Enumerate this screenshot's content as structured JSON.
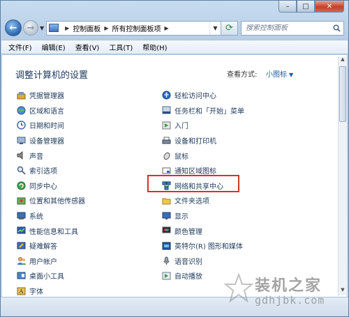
{
  "window": {
    "caption_buttons": {
      "minimize": "–",
      "maximize": "□",
      "close": "✕"
    }
  },
  "navbar": {
    "breadcrumb": [
      "控制面板",
      "所有控制面板项"
    ],
    "search_placeholder": "搜索控制面板"
  },
  "menubar": {
    "items": [
      "文件(F)",
      "编辑(E)",
      "查看(V)",
      "工具(T)",
      "帮助(H)"
    ]
  },
  "content": {
    "title": "调整计算机的设置",
    "view_label": "查看方式:",
    "view_value": "小图标",
    "left_items": [
      {
        "label": "凭据管理器",
        "icon": "credential-icon"
      },
      {
        "label": "区域和语言",
        "icon": "globe-icon"
      },
      {
        "label": "日期和时间",
        "icon": "clock-icon"
      },
      {
        "label": "设备管理器",
        "icon": "device-manager-icon"
      },
      {
        "label": "声音",
        "icon": "speaker-icon"
      },
      {
        "label": "索引选项",
        "icon": "index-icon"
      },
      {
        "label": "同步中心",
        "icon": "sync-icon"
      },
      {
        "label": "位置和其他传感器",
        "icon": "location-icon"
      },
      {
        "label": "系统",
        "icon": "system-icon"
      },
      {
        "label": "性能信息和工具",
        "icon": "performance-icon"
      },
      {
        "label": "疑难解答",
        "icon": "troubleshoot-icon"
      },
      {
        "label": "用户帐户",
        "icon": "user-accounts-icon"
      },
      {
        "label": "桌面小工具",
        "icon": "gadgets-icon"
      },
      {
        "label": "字体",
        "icon": "fonts-icon"
      }
    ],
    "right_items": [
      {
        "label": "轻松访问中心",
        "icon": "ease-of-access-icon"
      },
      {
        "label": "任务栏和「开始」菜单",
        "icon": "taskbar-icon"
      },
      {
        "label": "入门",
        "icon": "getting-started-icon"
      },
      {
        "label": "设备和打印机",
        "icon": "printer-icon"
      },
      {
        "label": "鼠标",
        "icon": "mouse-icon"
      },
      {
        "label": "通知区域图标",
        "icon": "notification-icon"
      },
      {
        "label": "网络和共享中心",
        "icon": "network-icon"
      },
      {
        "label": "文件夹选项",
        "icon": "folder-options-icon"
      },
      {
        "label": "显示",
        "icon": "display-icon"
      },
      {
        "label": "颜色管理",
        "icon": "color-management-icon"
      },
      {
        "label": "英特尔(R) 图形和媒体",
        "icon": "intel-graphics-icon"
      },
      {
        "label": "语音识别",
        "icon": "microphone-icon"
      },
      {
        "label": "自动播放",
        "icon": "autoplay-icon"
      }
    ]
  },
  "watermark": {
    "text": "装机之家",
    "url": "gdhjbk.com"
  },
  "colors": {
    "highlight": "#d5312b",
    "link": "#1e395b",
    "accent": "#1e5aa8"
  }
}
